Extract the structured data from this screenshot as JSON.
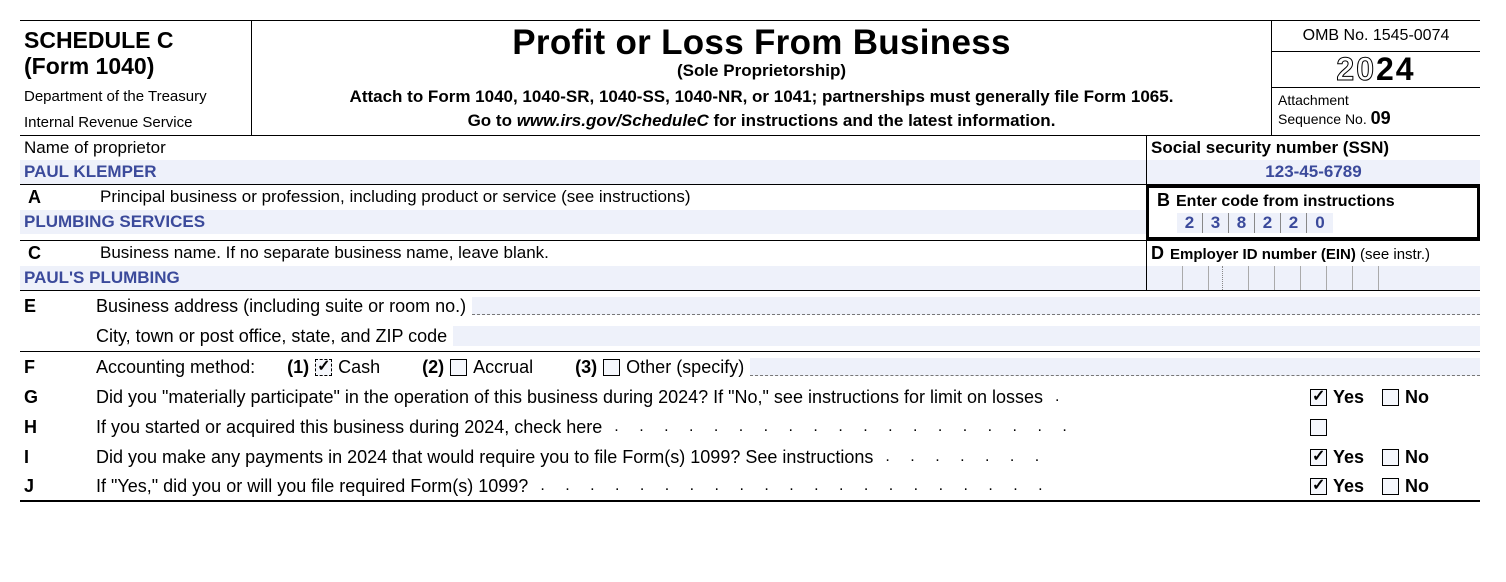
{
  "header": {
    "schedule": "SCHEDULE C",
    "form": "(Form 1040)",
    "dept1": "Department of the Treasury",
    "dept2": "Internal Revenue Service",
    "title": "Profit or Loss From Business",
    "subtitle": "(Sole Proprietorship)",
    "attach": "Attach to Form 1040, 1040-SR, 1040-SS, 1040-NR, or 1041; partnerships must generally file Form 1065.",
    "goto_pre": "Go to ",
    "goto_ital": "www.irs.gov/ScheduleC",
    "goto_post": " for instructions and the latest information.",
    "omb": "OMB No. 1545-0074",
    "year_outline": "20",
    "year_bold": "24",
    "attach_seq_label": "Attachment",
    "attach_seq_label2": "Sequence No. ",
    "attach_seq_no": "09"
  },
  "proprietor": {
    "label": "Name of proprietor",
    "value": "PAUL KLEMPER",
    "ssn_label": "Social security number (SSN)",
    "ssn_value": "123-45-6789"
  },
  "lineA": {
    "letter": "A",
    "label": "Principal business or profession, including product or service (see instructions)",
    "value": "PLUMBING SERVICES"
  },
  "lineB": {
    "letter": "B",
    "label": "Enter code from instructions",
    "code": [
      "2",
      "3",
      "8",
      "2",
      "2",
      "0"
    ]
  },
  "lineC": {
    "letter": "C",
    "label": "Business name. If no separate business name, leave blank.",
    "value": "PAUL'S PLUMBING"
  },
  "lineD": {
    "letter": "D",
    "label_main": "Employer ID number (EIN)",
    "label_note": " (see instr.)"
  },
  "lineE": {
    "letter": "E",
    "label1": "Business address (including suite or room no.)",
    "label2": "City, town or post office, state, and ZIP code"
  },
  "lineF": {
    "letter": "F",
    "label": "Accounting method:",
    "opt1_no": "(1)",
    "opt1": "Cash",
    "opt2_no": "(2)",
    "opt2": "Accrual",
    "opt3_no": "(3)",
    "opt3": "Other (specify)",
    "cash_checked": true
  },
  "lineG": {
    "letter": "G",
    "text": "Did you \"materially participate\" in the operation of this business during 2024? If \"No,\" see instructions for limit on losses",
    "yes_checked": true,
    "no_checked": false
  },
  "lineH": {
    "letter": "H",
    "text": "If you started or acquired this business during 2024, check here",
    "checked": false
  },
  "lineI": {
    "letter": "I",
    "text": "Did you make any payments in 2024 that would require you to file Form(s) 1099? See instructions",
    "yes_checked": true,
    "no_checked": false
  },
  "lineJ": {
    "letter": "J",
    "text": "If \"Yes,\" did you or will you file required Form(s) 1099?",
    "yes_checked": true,
    "no_checked": false
  },
  "yn": {
    "yes": "Yes",
    "no": "No"
  }
}
